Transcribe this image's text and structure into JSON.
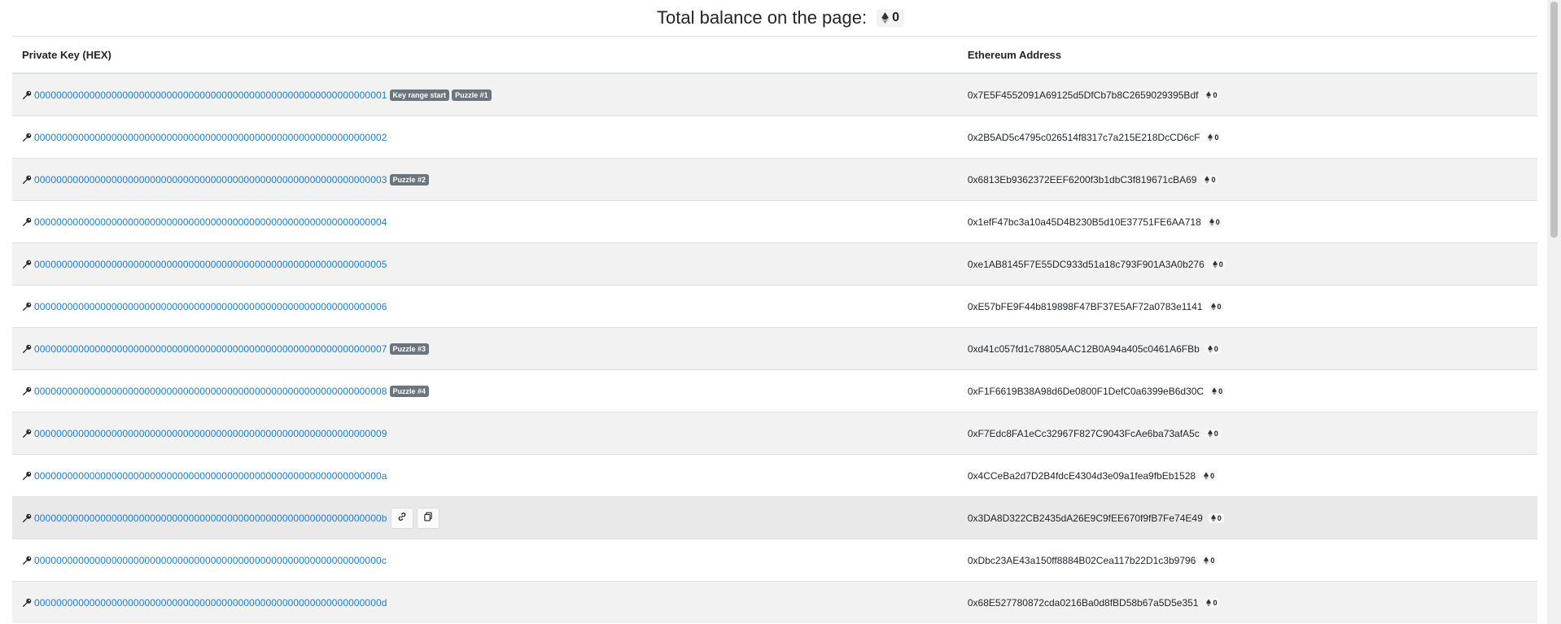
{
  "header": {
    "total_label": "Total balance on the page:",
    "total_value": "0"
  },
  "table": {
    "columns": [
      "Private Key (HEX)",
      "Ethereum Address"
    ],
    "rows": [
      {
        "key": "0000000000000000000000000000000000000000000000000000000000000001",
        "tags": [
          "Key range start",
          "Puzzle #1"
        ],
        "address": "0x7E5F4552091A69125d5DfCb7b8C2659029395Bdf",
        "balance": "0"
      },
      {
        "key": "0000000000000000000000000000000000000000000000000000000000000002",
        "tags": [],
        "address": "0x2B5AD5c4795c026514f8317c7a215E218DcCD6cF",
        "balance": "0"
      },
      {
        "key": "0000000000000000000000000000000000000000000000000000000000000003",
        "tags": [
          "Puzzle #2"
        ],
        "address": "0x6813Eb9362372EEF6200f3b1dbC3f819671cBA69",
        "balance": "0"
      },
      {
        "key": "0000000000000000000000000000000000000000000000000000000000000004",
        "tags": [],
        "address": "0x1efF47bc3a10a45D4B230B5d10E37751FE6AA718",
        "balance": "0"
      },
      {
        "key": "0000000000000000000000000000000000000000000000000000000000000005",
        "tags": [],
        "address": "0xe1AB8145F7E55DC933d51a18c793F901A3A0b276",
        "balance": "0"
      },
      {
        "key": "0000000000000000000000000000000000000000000000000000000000000006",
        "tags": [],
        "address": "0xE57bFE9F44b819898F47BF37E5AF72a0783e1141",
        "balance": "0"
      },
      {
        "key": "0000000000000000000000000000000000000000000000000000000000000007",
        "tags": [
          "Puzzle #3"
        ],
        "address": "0xd41c057fd1c78805AAC12B0A94a405c0461A6FBb",
        "balance": "0"
      },
      {
        "key": "0000000000000000000000000000000000000000000000000000000000000008",
        "tags": [
          "Puzzle #4"
        ],
        "address": "0xF1F6619B38A98d6De0800F1DefC0a6399eB6d30C",
        "balance": "0"
      },
      {
        "key": "0000000000000000000000000000000000000000000000000000000000000009",
        "tags": [],
        "address": "0xF7Edc8FA1eCc32967F827C9043FcAe6ba73afA5c",
        "balance": "0"
      },
      {
        "key": "000000000000000000000000000000000000000000000000000000000000000a",
        "tags": [],
        "address": "0x4CCeBa2d7D2B4fdcE4304d3e09a1fea9fbEb1528",
        "balance": "0"
      },
      {
        "key": "000000000000000000000000000000000000000000000000000000000000000b",
        "tags": [],
        "address": "0x3DA8D322CB2435dA26E9C9fEE670f9fB7Fe74E49",
        "balance": "0",
        "hover": true
      },
      {
        "key": "000000000000000000000000000000000000000000000000000000000000000c",
        "tags": [],
        "address": "0xDbc23AE43a150ff8884B02Cea117b22D1c3b9796",
        "balance": "0"
      },
      {
        "key": "000000000000000000000000000000000000000000000000000000000000000d",
        "tags": [],
        "address": "0x68E527780872cda0216Ba0d8fBD58b67a5D5e351",
        "balance": "0"
      }
    ]
  },
  "icons": {
    "key": "key-icon",
    "eth": "ethereum-icon",
    "link": "link-icon",
    "copy": "copy-icon"
  }
}
